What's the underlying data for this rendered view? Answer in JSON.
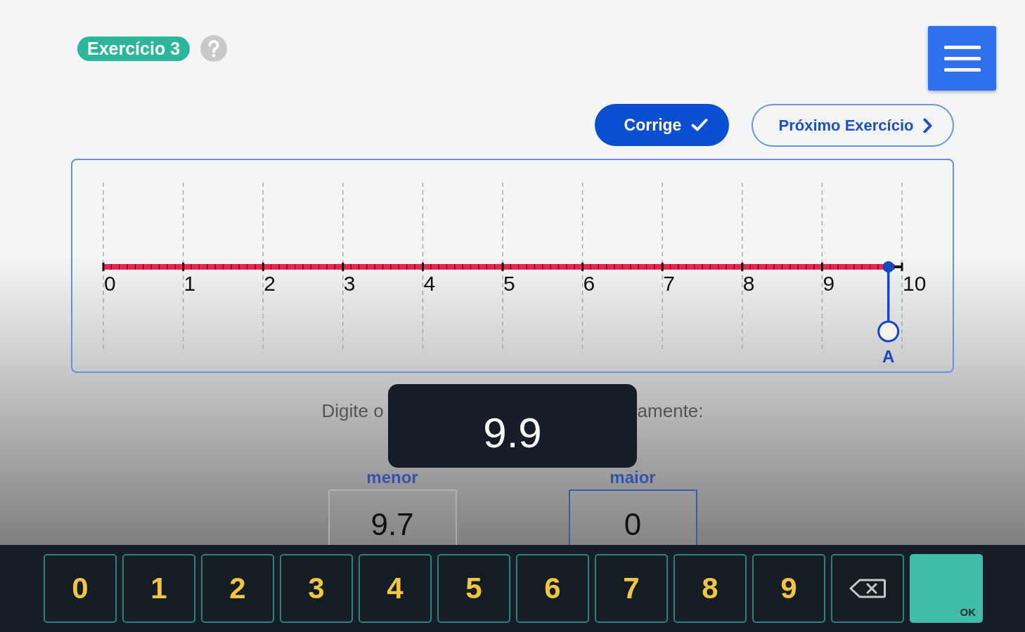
{
  "header": {
    "badge": "Exercício 3"
  },
  "actions": [
    {
      "kind": "primary",
      "label": "Corrige"
    },
    {
      "kind": "secondary",
      "label": "Próximo Exercício"
    }
  ],
  "number_line": {
    "labels": [
      "0",
      "1",
      "2",
      "3",
      "4",
      "5",
      "6",
      "7",
      "8",
      "9",
      "10"
    ],
    "point": {
      "label": "A",
      "level": 0.983
    }
  },
  "instruction": [
    "Digite o",
    "amente:"
  ],
  "popup": {
    "value": "9.9"
  },
  "fields": [
    {
      "label": "menor",
      "value": "9.7",
      "focused": false
    },
    {
      "label": "maior",
      "value": "0",
      "focused": true
    }
  ],
  "keypad": [
    {
      "kind": "digit",
      "label": "0"
    },
    {
      "kind": "digit",
      "label": "1"
    },
    {
      "kind": "digit",
      "label": "2"
    },
    {
      "kind": "digit",
      "label": "3"
    },
    {
      "kind": "digit",
      "label": "4"
    },
    {
      "kind": "digit",
      "label": "5"
    },
    {
      "kind": "digit",
      "label": "6"
    },
    {
      "kind": "digit",
      "label": "7"
    },
    {
      "kind": "digit",
      "label": "8"
    },
    {
      "kind": "digit",
      "label": "9"
    },
    {
      "kind": "backspace"
    },
    {
      "kind": "ok",
      "label": "OK"
    }
  ]
}
